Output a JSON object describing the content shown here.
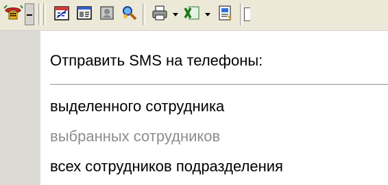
{
  "toolbar": {
    "buttons": [
      {
        "icon": "telephone-icon"
      },
      {
        "icon": "dropdown-arrow-icon"
      },
      {
        "icon": "calendar-icon"
      },
      {
        "icon": "card-index-icon"
      },
      {
        "icon": "id-badge-icon"
      },
      {
        "icon": "find-people-icon"
      },
      {
        "icon": "printer-icon"
      },
      {
        "icon": "excel-export-icon"
      },
      {
        "icon": "save-document-icon"
      }
    ],
    "colors": {
      "face": "#ece9d8",
      "pressed": "#d6d3ce"
    }
  },
  "menu": {
    "header": "Отправить SMS на телефоны:",
    "items": [
      {
        "label": "выделенного сотрудника",
        "enabled": true
      },
      {
        "label": "выбранных сотрудников",
        "enabled": false
      },
      {
        "label": "всех сотрудников подразделения",
        "enabled": true
      }
    ],
    "colors": {
      "text": "#000000",
      "disabled_text": "#8d8d8d",
      "gutter": "#dcdad5"
    }
  }
}
